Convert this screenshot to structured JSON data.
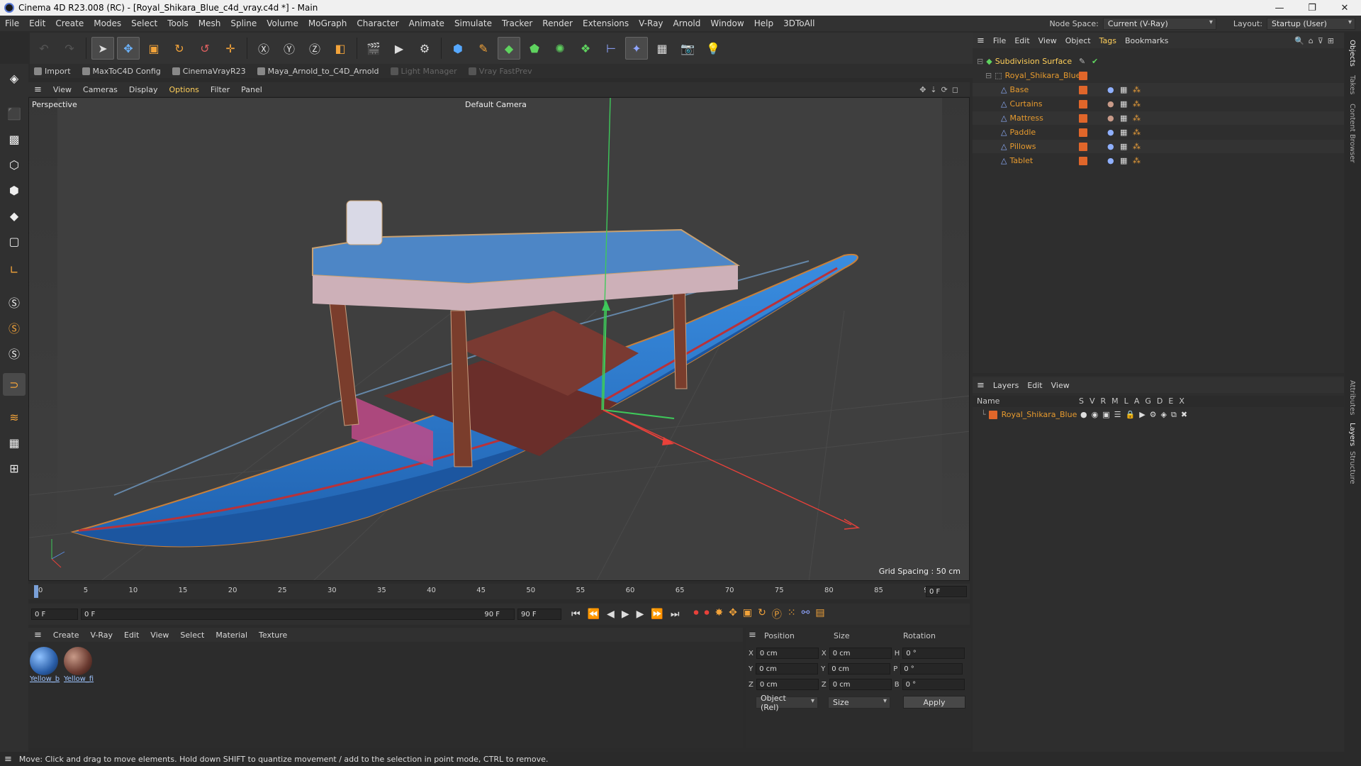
{
  "window": {
    "title": "Cinema 4D R23.008 (RC) - [Royal_Shikara_Blue_c4d_vray.c4d *] - Main"
  },
  "menu": [
    "File",
    "Edit",
    "Create",
    "Modes",
    "Select",
    "Tools",
    "Mesh",
    "Spline",
    "Volume",
    "MoGraph",
    "Character",
    "Animate",
    "Simulate",
    "Tracker",
    "Render",
    "Extensions",
    "V-Ray",
    "Arnold",
    "Window",
    "Help",
    "3DToAll"
  ],
  "node_space": {
    "label": "Node Space:",
    "value": "Current (V-Ray)"
  },
  "layout": {
    "label": "Layout:",
    "value": "Startup (User)"
  },
  "plugins": [
    {
      "label": "Import",
      "enabled": true
    },
    {
      "label": "MaxToC4D Config",
      "enabled": true
    },
    {
      "label": "CinemaVrayR23",
      "enabled": true
    },
    {
      "label": "Maya_Arnold_to_C4D_Arnold",
      "enabled": true
    },
    {
      "label": "Light Manager",
      "enabled": false
    },
    {
      "label": "Vray FastPrev",
      "enabled": false
    }
  ],
  "viewport_menu": [
    "View",
    "Cameras",
    "Display",
    "Options",
    "Filter",
    "Panel"
  ],
  "viewport": {
    "name": "Perspective",
    "camera": "Default Camera",
    "grid": "Grid Spacing : 50 cm"
  },
  "timeline": {
    "ticks": [
      "0",
      "5",
      "10",
      "15",
      "20",
      "25",
      "30",
      "35",
      "40",
      "45",
      "50",
      "55",
      "60",
      "65",
      "70",
      "75",
      "80",
      "85",
      "90"
    ],
    "frame_right": "0 F"
  },
  "transport": {
    "start": "0 F",
    "cur": "0 F",
    "end": "90 F",
    "end2": "90 F"
  },
  "material_menu": [
    "Create",
    "V-Ray",
    "Edit",
    "View",
    "Select",
    "Material",
    "Texture"
  ],
  "materials": [
    "Yellow_b",
    "Yellow_fi"
  ],
  "attributes": {
    "headers": [
      "Position",
      "Size",
      "Rotation"
    ],
    "rows": [
      {
        "axis": "X",
        "pos": "0 cm",
        "saxis": "X",
        "size": "0 cm",
        "raxis": "H",
        "rot": "0 °"
      },
      {
        "axis": "Y",
        "pos": "0 cm",
        "saxis": "Y",
        "size": "0 cm",
        "raxis": "P",
        "rot": "0 °"
      },
      {
        "axis": "Z",
        "pos": "0 cm",
        "saxis": "Z",
        "size": "0 cm",
        "raxis": "B",
        "rot": "0 °"
      }
    ],
    "mode": "Object (Rel)",
    "size_mode": "Size",
    "apply": "Apply"
  },
  "object_menu": [
    "File",
    "Edit",
    "View",
    "Object",
    "Tags",
    "Bookmarks"
  ],
  "objects": {
    "root": "Subdivision Surface",
    "group": "Royal_Shikara_Blue",
    "children": [
      "Base",
      "Curtains",
      "Mattress",
      "Paddle",
      "Pillows",
      "Tablet"
    ]
  },
  "layer_menu": [
    "Layers",
    "Edit",
    "View"
  ],
  "layers": {
    "header": "Name",
    "cols": [
      "S",
      "V",
      "R",
      "M",
      "L",
      "A",
      "G",
      "D",
      "E",
      "X"
    ],
    "items": [
      "Royal_Shikara_Blue"
    ]
  },
  "right_tabs": [
    "Objects",
    "Takes",
    "Content Browser",
    "Attributes",
    "Layers",
    "Structure"
  ],
  "status": "Move: Click and drag to move elements. Hold down SHIFT to quantize movement / add to the selection in point mode, CTRL to remove.",
  "colors": {
    "accent": "#e69a2e",
    "boat": "#2f86d6",
    "x_axis": "#e8413a",
    "y_axis": "#3ec95a"
  }
}
